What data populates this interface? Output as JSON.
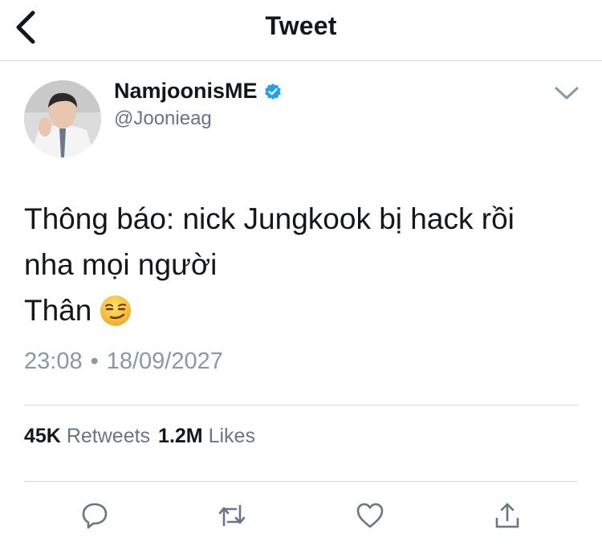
{
  "header": {
    "title": "Tweet"
  },
  "tweet": {
    "display_name": "NamjoonisME",
    "handle": "@Joonieag",
    "verified": true,
    "text_line1": "Thông báo: nick Jungkook bị hack rồi",
    "text_line2": "nha mọi người",
    "text_line3": "Thân",
    "emoji": "smirking-face",
    "time": "23:08",
    "date": "18/09/2027"
  },
  "stats": {
    "retweets_count": "45K",
    "retweets_label": "Retweets",
    "likes_count": "1.2M",
    "likes_label": "Likes"
  },
  "icons": {
    "back": "chevron-left-icon",
    "verified": "verified-badge-icon",
    "more": "chevron-down-icon",
    "reply": "reply-icon",
    "retweet": "retweet-icon",
    "like": "heart-icon",
    "share": "share-icon"
  },
  "colors": {
    "text": "#14171a",
    "secondary": "#657786",
    "verified": "#1da1f2",
    "icon": "#657786"
  }
}
